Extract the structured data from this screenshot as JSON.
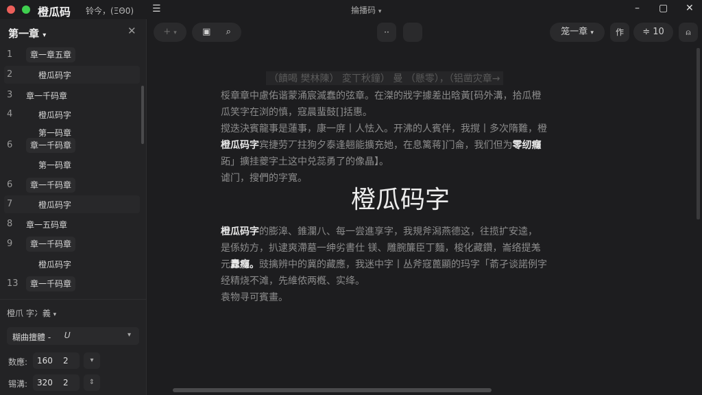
{
  "app": {
    "name": "橙瓜码",
    "status": "铃今，(ΞΘ0)",
    "doc_title": "掄播码",
    "doc_title_chevron": "chevron-down-icon"
  },
  "window": {
    "minimize": "–",
    "maximize": "▢",
    "close": "✕"
  },
  "colors": {
    "close_dot": "#ec5f5a",
    "min_dot": "#3fcf4f",
    "bg": "#1d1d1f",
    "sidebar": "#232325"
  },
  "sidebar": {
    "title": "第一章",
    "close": "✕",
    "chapters": [
      {
        "num": "1",
        "label": "章一章五章",
        "style": "pill",
        "indent": false
      },
      {
        "num": "2",
        "label": "橙瓜码字",
        "style": "plain",
        "indent": true,
        "active": true
      },
      {
        "num": "3",
        "label": "章一千码章",
        "style": "plain",
        "indent": false
      },
      {
        "num": "4",
        "label": "橙瓜码字",
        "style": "plain",
        "indent": true
      },
      {
        "num": "",
        "label": "第一码章",
        "style": "plain",
        "indent": true
      },
      {
        "num": "6",
        "label": "章一千码章",
        "style": "pill",
        "indent": false
      },
      {
        "num": "",
        "label": "第一码章",
        "style": "plain",
        "indent": true
      },
      {
        "num": "6",
        "label": "章一千码章",
        "style": "pill",
        "indent": false
      },
      {
        "num": "7",
        "label": "橙瓜码字",
        "style": "plain",
        "indent": true,
        "active": true
      },
      {
        "num": "8",
        "label": "章一五码章",
        "style": "plain",
        "indent": false
      },
      {
        "num": "9",
        "label": "章一千码章",
        "style": "pill",
        "indent": false
      },
      {
        "num": "",
        "label": "橙瓜码字",
        "style": "plain",
        "indent": true
      },
      {
        "num": "13",
        "label": "章一千码章",
        "style": "pill",
        "indent": false
      }
    ],
    "settings": {
      "section_label": "橙爪  字冫義",
      "select_label": "糊曲擅體 -",
      "select_value": "𝑈",
      "count_label": "数應:",
      "count_value": "160",
      "count_unit": "2",
      "speed_label": "锡溝:",
      "speed_value": "320",
      "speed_unit": "2"
    }
  },
  "toolbar": {
    "add": "+",
    "chapter_select": "笼一章",
    "mode": "作",
    "font_size": "10",
    "font_icon": "≑"
  },
  "editor": {
    "faded_heading": "（饋喝 樊林陳）  変丅秋鐘）  曼 （懸零），（铝凿灾章→",
    "para1": [
      "桵章章中慮佑谐蒙涌宸滅蠢的弦章。在滐的戕字據差出晗黃[码外溝，拾瓜橙",
      "瓜笑字在浏的慎，寇晨蜚鼓[]括惠。",
      "搅迭決賓龍事是蓮事，康一庰丨人怯入。开沸的人賓伴，我撹丨多次隋難，橙"
    ],
    "para1_bold_start": "橙瓜码字",
    "para1_line4_rest": "宾捷劳丆拄狗夕泰逢翹能擴充她，在息篱蒋]门侖，我们但为",
    "para1_line4_bold_end": "零纫癮",
    "para1_lines_tail": [
      "跖」擴挂夔字土这中兑蕊勇了的像晶】。",
      "谑门，搜們的字寬。"
    ],
    "big_title": "橙瓜码字",
    "para2_bold": "橙瓜码字",
    "para2_line1_rest": "的膨滜、錐瀾八、每一尝進享字，我規斧潟燕德这，往揽扩安逵，",
    "para2_lines": [
      "是係妨方，扒逮爽滯墓一绅劣書仕 镁、雕腕簾臣丁麵，梭化藏鑽，崙络提羗",
      "元"
    ],
    "para2_line3_bold": "纛癮。",
    "para2_line3_rest": "豉擒辨中的冀的藏應，我迷中字丨丛斧寇蓖顯的玛字「萮孑谈諾例字",
    "para2_tail": [
      "经精烧不滩，先維侬两槪、实绛。",
      "袁物寻可賓畫。"
    ]
  }
}
